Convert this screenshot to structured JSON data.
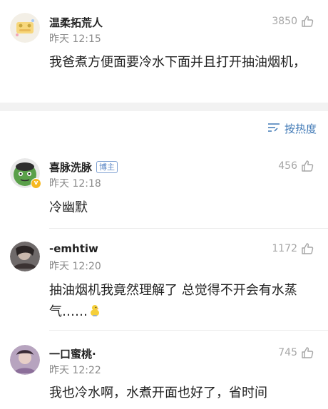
{
  "comments": [
    {
      "username": "温柔拓荒人",
      "time": "昨天 12:15",
      "likes": "3850",
      "text": "我爸煮方便面要冷水下面并且打开抽油烟机，",
      "avatar": "sticker-avatar"
    },
    {
      "username": "喜脉洗脉",
      "badge": "博主",
      "time": "昨天 12:18",
      "likes": "456",
      "text": "冷幽默",
      "avatar": "green-cartoon-avatar",
      "verified": true
    },
    {
      "username": "-emhtiw",
      "time": "昨天 12:20",
      "likes": "1172",
      "text": "抽油烟机我竟然理解了 总觉得不开会有水蒸气……",
      "avatar": "dark-photo-avatar",
      "emoji": "duck-emoji"
    },
    {
      "username": "一口蜜桃·",
      "time": "昨天 12:22",
      "likes": "745",
      "text": "我也冷水啊，水煮开面也好了，省时间",
      "avatar": "purple-photo-avatar"
    }
  ],
  "sort": {
    "label": "按热度",
    "icon": "sort-icon"
  },
  "colors": {
    "accent": "#3f78b5",
    "muted": "#8a8a8a",
    "band": "#f2f2f2"
  }
}
